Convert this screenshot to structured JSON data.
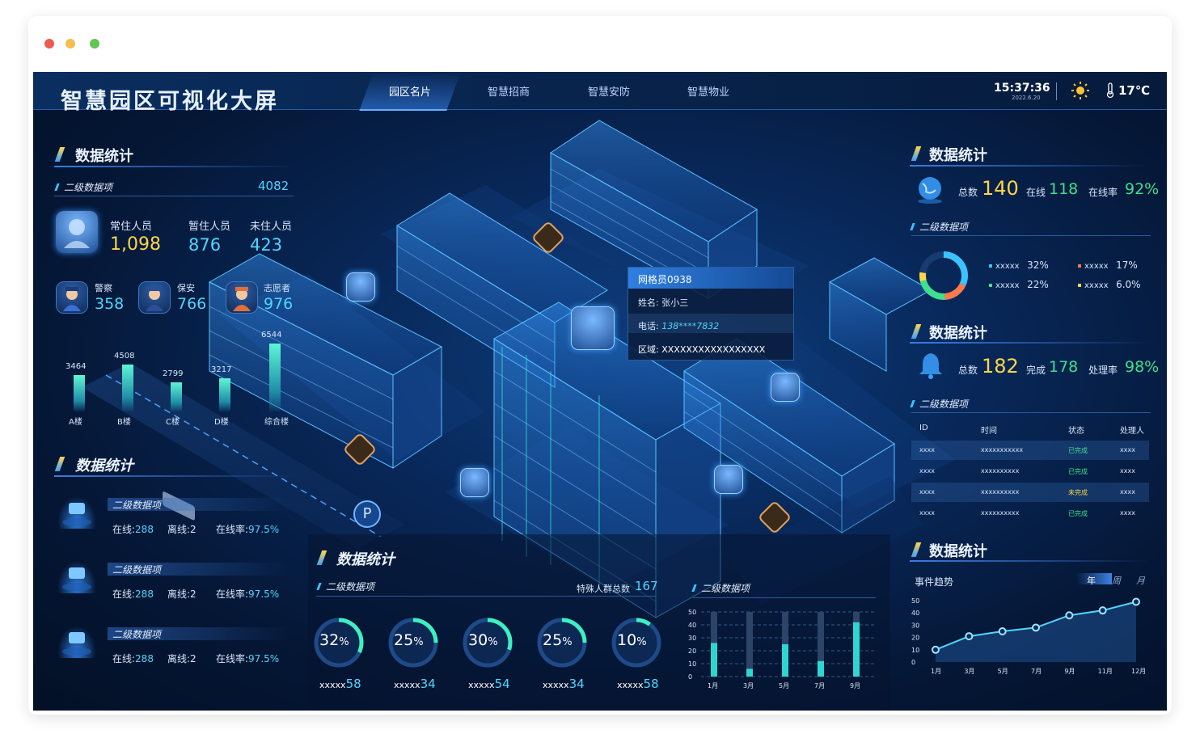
{
  "window": {
    "dots": [
      "#ec5b4f",
      "#f4bf4f",
      "#62c554"
    ]
  },
  "header": {
    "title": "智慧园区可视化大屏",
    "tabs": [
      "园区名片",
      "智慧招商",
      "智慧安防",
      "智慧物业"
    ],
    "time": "15:37:36",
    "date": "2022.6.20",
    "temperature": "17℃"
  },
  "left_top": {
    "section_title": "数据统计",
    "sub_label": "二级数据项",
    "sub_value": "4082",
    "stats": [
      {
        "label": "常住人员",
        "value": "1,098"
      },
      {
        "label": "暂住人员",
        "value": "876"
      },
      {
        "label": "未住人员",
        "value": "423"
      }
    ],
    "roles": [
      {
        "label": "警察",
        "value": "358"
      },
      {
        "label": "保安",
        "value": "766"
      },
      {
        "label": "志愿者",
        "value": "976"
      }
    ]
  },
  "chart_data": [
    {
      "type": "bar",
      "categories": [
        "A楼",
        "B楼",
        "C楼",
        "D楼",
        "综合楼"
      ],
      "values": [
        3464,
        4508,
        2799,
        3217,
        6544
      ]
    },
    {
      "type": "bar",
      "categories": [
        "1月",
        "3月",
        "5月",
        "7月",
        "9月"
      ],
      "values": [
        26,
        6,
        25,
        12,
        42
      ],
      "ylim": [
        0,
        50
      ],
      "yticks": [
        "50",
        "40",
        "30",
        "20",
        "10",
        "0"
      ]
    },
    {
      "type": "line",
      "title": "事件趋势",
      "categories": [
        "1月",
        "3月",
        "5月",
        "7月",
        "9月",
        "11月",
        "12月"
      ],
      "values": [
        10,
        21,
        25,
        28,
        38,
        42,
        49
      ],
      "yticks": [
        "50",
        "40",
        "30",
        "20",
        "10",
        "0"
      ],
      "ylim": [
        0,
        50
      ]
    }
  ],
  "left_bottom": {
    "section_title": "数据统计",
    "items": [
      {
        "title": "二级数据项",
        "online": "在线:",
        "online_val": "288",
        "offline": "离线:",
        "offline_val": "2",
        "rate": "在线率:",
        "rate_val": "97.5%"
      },
      {
        "title": "二级数据项",
        "online": "在线:",
        "online_val": "288",
        "offline": "离线:",
        "offline_val": "2",
        "rate": "在线率:",
        "rate_val": "97.5%"
      },
      {
        "title": "二级数据项",
        "online": "在线:",
        "online_val": "288",
        "offline": "离线:",
        "offline_val": "2",
        "rate": "在线率:",
        "rate_val": "97.5%"
      }
    ]
  },
  "bottom_center": {
    "section_title": "数据统计",
    "sub_label": "二级数据项",
    "special_label": "特殊人群总数",
    "special_value": "167",
    "rings": [
      {
        "pct": "32",
        "unit": "%",
        "name": "xxxxx",
        "value": "58"
      },
      {
        "pct": "25",
        "unit": "%",
        "name": "xxxxx",
        "value": "34"
      },
      {
        "pct": "30",
        "unit": "%",
        "name": "xxxxx",
        "value": "54"
      },
      {
        "pct": "25",
        "unit": "%",
        "name": "xxxxx",
        "value": "34"
      },
      {
        "pct": "10",
        "unit": "%",
        "name": "xxxxx",
        "value": "58"
      }
    ],
    "bar_sub_label": "二级数据项"
  },
  "right_top": {
    "section_title": "数据统计",
    "total_label": "总数",
    "total": "140",
    "online_label": "在线",
    "online": "118",
    "rate_label": "在线率",
    "rate": "92%",
    "sub_label": "二级数据项",
    "legend": [
      {
        "name": "xxxxx",
        "value": "32%",
        "color": "#3ac3ff"
      },
      {
        "name": "xxxxx",
        "value": "17%",
        "color": "#ff7a4a"
      },
      {
        "name": "xxxxx",
        "value": "22%",
        "color": "#3fe08c"
      },
      {
        "name": "xxxxx",
        "value": "6.0%",
        "color": "#ffd54a"
      }
    ]
  },
  "right_mid": {
    "section_title": "数据统计",
    "total_label": "总数",
    "total": "182",
    "done_label": "完成",
    "done": "178",
    "rate_label": "处理率",
    "rate": "98%",
    "sub_label": "二级数据项",
    "columns": [
      "ID",
      "时间",
      "状态",
      "处理人"
    ],
    "rows": [
      [
        "xxxx",
        "xxxxxxxxxxx",
        "已完成",
        "xxxx"
      ],
      [
        "xxxx",
        "xxxxxxxxxx",
        "已完成",
        "xxxx"
      ],
      [
        "xxxx",
        "xxxxxxxxxx",
        "未完成",
        "xxxx"
      ],
      [
        "xxxx",
        "xxxxxxxxxx",
        "已完成",
        "xxxx"
      ]
    ]
  },
  "right_bottom": {
    "section_title": "数据统计",
    "chart_title": "事件趋势",
    "periods": [
      "年",
      "周",
      "月"
    ]
  },
  "popup": {
    "header": "网格员0938",
    "name_label": "姓名:",
    "name": "张小三",
    "phone_label": "电话:",
    "phone": "138****7832",
    "area_label": "区域:",
    "area": "XXXXXXXXXXXXXXXXX"
  }
}
